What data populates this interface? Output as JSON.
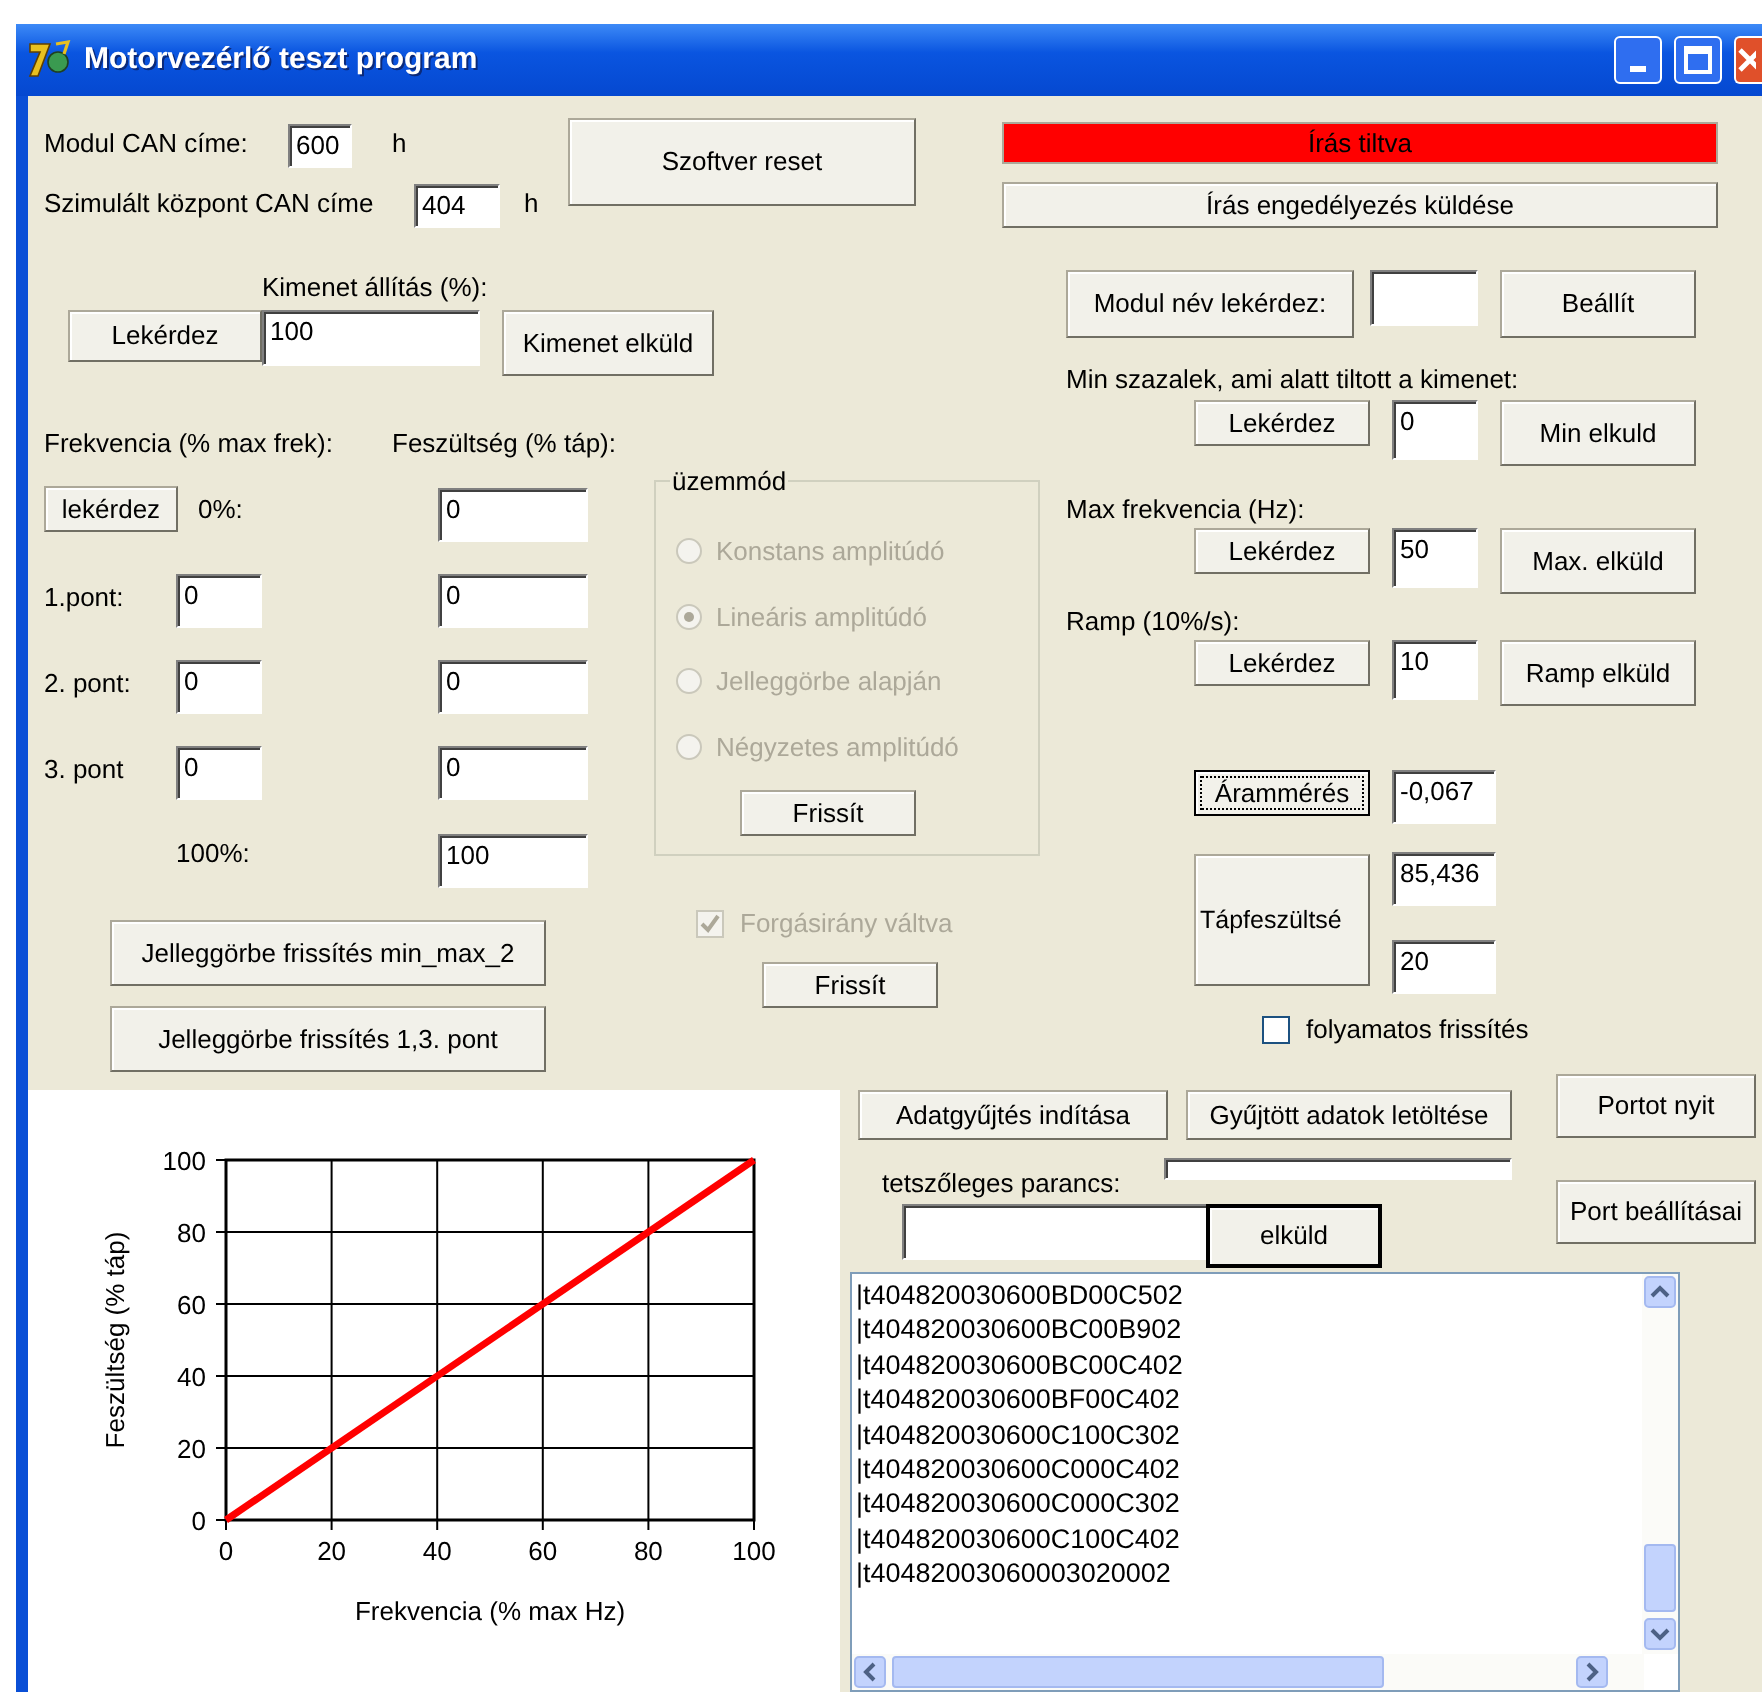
{
  "window": {
    "title": "Motorvezérlő teszt program"
  },
  "controls": [
    {
      "kind": "label",
      "text": "Modul CAN címe:"
    },
    {
      "kind": "field",
      "value": "600"
    },
    {
      "kind": "label",
      "text": "h"
    },
    {
      "kind": "label",
      "text": "Szimulált központ CAN címe"
    },
    {
      "kind": "field",
      "value": "404"
    },
    {
      "kind": "label",
      "text": "h"
    },
    {
      "kind": "button",
      "text": "Szoftver reset"
    },
    {
      "kind": "status",
      "text": "Írás tiltva",
      "alarm": true
    },
    {
      "kind": "button",
      "text": "Írás engedélyezés küldése"
    },
    {
      "kind": "label",
      "text": "Kimenet állítás (%):"
    },
    {
      "kind": "button",
      "text": "Lekérdez"
    },
    {
      "kind": "field",
      "value": "100"
    },
    {
      "kind": "button",
      "text": "Kimenet elküld"
    },
    {
      "kind": "label",
      "text": "Frekvencia (% max frek):"
    },
    {
      "kind": "label",
      "text": "Feszültség (% táp):"
    },
    {
      "kind": "button",
      "text": "lekérdez"
    },
    {
      "kind": "label",
      "text": "0%:"
    },
    {
      "kind": "field",
      "value": "0"
    },
    {
      "kind": "label",
      "text": "1.pont:"
    },
    {
      "kind": "field",
      "value": "0"
    },
    {
      "kind": "field",
      "value": "0"
    },
    {
      "kind": "label",
      "text": "2. pont:"
    },
    {
      "kind": "field",
      "value": "0"
    },
    {
      "kind": "field",
      "value": "0"
    },
    {
      "kind": "label",
      "text": "3. pont"
    },
    {
      "kind": "field",
      "value": "0"
    },
    {
      "kind": "field",
      "value": "0"
    },
    {
      "kind": "label",
      "text": "100%:"
    },
    {
      "kind": "field",
      "value": "100"
    },
    {
      "kind": "button",
      "text": "Jelleggörbe frissítés min_max_2"
    },
    {
      "kind": "button",
      "text": "Jelleggörbe frissítés 1,3. pont"
    },
    {
      "kind": "checkbox",
      "text": "Forgásirány váltva",
      "checked": true,
      "disabled": true
    },
    {
      "kind": "button",
      "text": "Frissít"
    },
    {
      "kind": "button",
      "text": "Modul név lekérdez:"
    },
    {
      "kind": "field"
    },
    {
      "kind": "button",
      "text": "Beállít"
    },
    {
      "kind": "label",
      "text": "Min szazalek, ami alatt tiltott a kimenet:"
    },
    {
      "kind": "button",
      "text": "Lekérdez"
    },
    {
      "kind": "field",
      "value": "0"
    },
    {
      "kind": "button",
      "text": "Min elkuld"
    },
    {
      "kind": "label",
      "text": "Max frekvencia (Hz):"
    },
    {
      "kind": "button",
      "text": "Lekérdez"
    },
    {
      "kind": "field",
      "value": "50"
    },
    {
      "kind": "button",
      "text": "Max. elküld"
    },
    {
      "kind": "label",
      "text": "Ramp (10%/s):"
    },
    {
      "kind": "button",
      "text": "Lekérdez"
    },
    {
      "kind": "field",
      "value": "10"
    },
    {
      "kind": "button",
      "text": "Ramp elküld"
    },
    {
      "kind": "button",
      "text": "Árammérés",
      "focused": true
    },
    {
      "kind": "field",
      "value": "-0,067"
    },
    {
      "kind": "button",
      "text": "Tápfeszültsé"
    },
    {
      "kind": "field",
      "value": "85,436"
    },
    {
      "kind": "field",
      "value": "20"
    },
    {
      "kind": "checkbox",
      "text": "folyamatos frissítés",
      "checked": false,
      "disabled": false
    },
    {
      "kind": "button",
      "text": "Adatgyűjtés indítása"
    },
    {
      "kind": "button",
      "text": "Gyűjtött adatok letöltése"
    },
    {
      "kind": "button",
      "text": "Portot nyit"
    },
    {
      "kind": "label",
      "text": "tetszőleges parancs:"
    },
    {
      "kind": "field"
    },
    {
      "kind": "field"
    },
    {
      "kind": "button",
      "text": "elküld",
      "default": true
    },
    {
      "kind": "button",
      "text": "Port beállításai"
    }
  ],
  "mode_group": {
    "title": "üzemmód",
    "options": [
      {
        "label": "Konstans amplitúdó",
        "selected": false,
        "disabled": true
      },
      {
        "label": "Lineáris amplitúdó",
        "selected": true,
        "disabled": true
      },
      {
        "label": "Jelleggörbe alapján",
        "selected": false,
        "disabled": true
      },
      {
        "label": "Négyzetes amplitúdó",
        "selected": false,
        "disabled": true
      }
    ],
    "button": "Frissít"
  },
  "log": {
    "lines": [
      "|t404820030600BD00C502",
      "|t404820030600BC00B902",
      "|t404820030600BC00C402",
      "|t404820030600BF00C402",
      "|t404820030600C100C302",
      "|t404820030600C000C402",
      "|t404820030600C000C302",
      "|t404820030600C100C402",
      "|t40482003060003020002"
    ]
  },
  "chart": {
    "chart_data": {
      "type": "line",
      "xlabel": "Frekvencia (% max Hz)",
      "ylabel": "Feszültség (% táp)",
      "x": [
        0,
        100
      ],
      "series": [
        {
          "color": "#ff0000",
          "values": [
            0,
            100
          ]
        }
      ],
      "grid": true,
      "xlim": [
        0,
        100
      ],
      "ylim": [
        0,
        100
      ],
      "xticks": [
        0,
        20,
        40,
        60,
        80,
        100
      ],
      "yticks": [
        0,
        20,
        40,
        60,
        80,
        100
      ]
    }
  }
}
